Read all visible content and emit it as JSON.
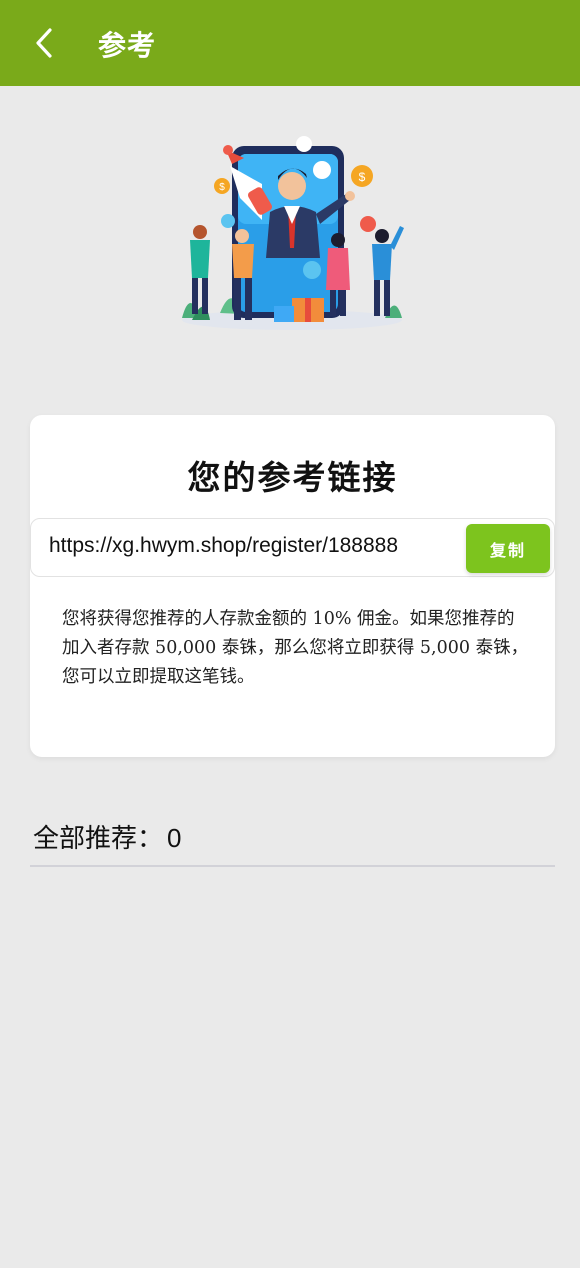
{
  "header": {
    "title": "参考",
    "back_icon": "chevron-left-icon",
    "background": "#7aaa1a"
  },
  "hero": {
    "illustration": "referral-megaphone-illustration"
  },
  "card": {
    "title": "您的参考链接",
    "link": "https://xg.hwym.shop/register/188888",
    "copy_label": "复制",
    "copy_color": "#7dc41e",
    "description": "您将获得您推荐的人存款金额的 10% 佣金。如果您推荐的加入者存款 50,000 泰铢，那么您将立即获得 5,000 泰铢，您可以立即提取这笔钱。"
  },
  "referrals": {
    "label": "全部推荐：",
    "count": "0"
  }
}
